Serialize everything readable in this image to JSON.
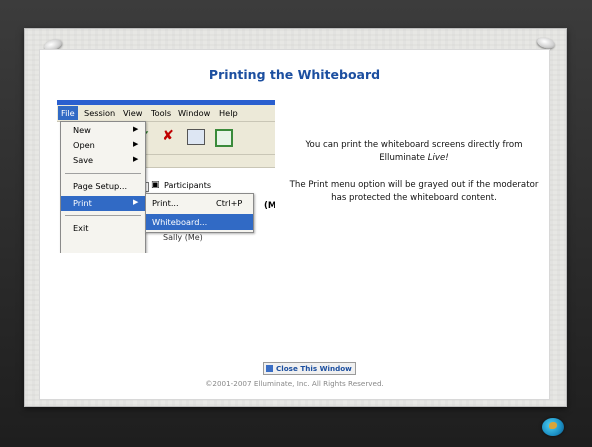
{
  "slide": {
    "title": "Printing the Whiteboard",
    "description_line1_part1": "You can print the whiteboard screens directly from Elluminate ",
    "description_line1_italic": "Live!",
    "description_line2": "The Print menu option will be grayed out if the moderator has protected the whiteboard content.",
    "close_button_label": "Close This Window",
    "copyright": "©2001-2007 Elluminate, Inc. All Rights Reserved."
  },
  "app_screenshot": {
    "menubar": {
      "file": "File",
      "session": "Session",
      "view": "View",
      "tools": "Tools",
      "window": "Window",
      "help": "Help"
    },
    "file_menu": {
      "new": "New",
      "open": "Open",
      "save": "Save",
      "page_setup": "Page Setup...",
      "print": "Print",
      "exit": "Exit"
    },
    "print_submenu": {
      "print": "Print...",
      "print_shortcut": "Ctrl+P",
      "whiteboard": "Whiteboard..."
    },
    "participants_label": "Participants",
    "participant_name": "Sally (Me)",
    "partial_label": "(M"
  },
  "colors": {
    "title": "#1c4fa0",
    "menu_highlight": "#316ac5"
  }
}
